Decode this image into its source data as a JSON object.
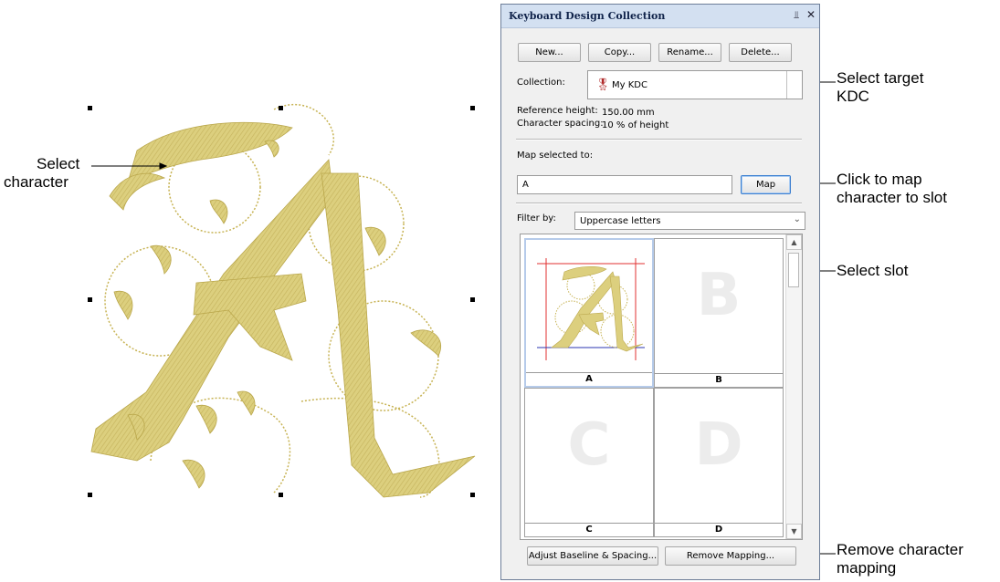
{
  "callouts": {
    "select_character": [
      "Select",
      "character"
    ],
    "select_target_kdc": [
      "Select target",
      "KDC"
    ],
    "click_to_map": [
      "Click to map",
      "character to slot"
    ],
    "select_slot": [
      "Select slot"
    ],
    "remove_mapping": [
      "Remove character",
      "mapping"
    ]
  },
  "panel": {
    "title": "Keyboard Design Collection",
    "pin_icon": "pin-icon",
    "close_icon": "close-icon",
    "buttons": {
      "new": "New...",
      "copy": "Copy...",
      "rename": "Rename...",
      "delete": "Delete..."
    },
    "collection_label": "Collection:",
    "collection_value": "My KDC",
    "reference_height_label": "Reference height:",
    "reference_height_value": "150.00 mm",
    "character_spacing_label": "Character spacing:",
    "character_spacing_value": "10 % of height",
    "map_selected_label": "Map selected to:",
    "map_input_value": "A",
    "map_button": "Map",
    "filter_label": "Filter by:",
    "filter_value": "Uppercase letters",
    "slots": [
      {
        "caption": "A",
        "letter": "",
        "selected": true
      },
      {
        "caption": "B",
        "letter": "B",
        "selected": false
      },
      {
        "caption": "C",
        "letter": "C",
        "selected": false
      },
      {
        "caption": "D",
        "letter": "D",
        "selected": false
      }
    ],
    "adjust_button": "Adjust Baseline & Spacing...",
    "remove_button": "Remove Mapping..."
  },
  "colors": {
    "gold": "#d8cc7a",
    "gold_dark": "#bca94f",
    "guide_red": "#e23030",
    "guide_blue": "#2b35b0",
    "titlebar": "#d3e0f1"
  }
}
